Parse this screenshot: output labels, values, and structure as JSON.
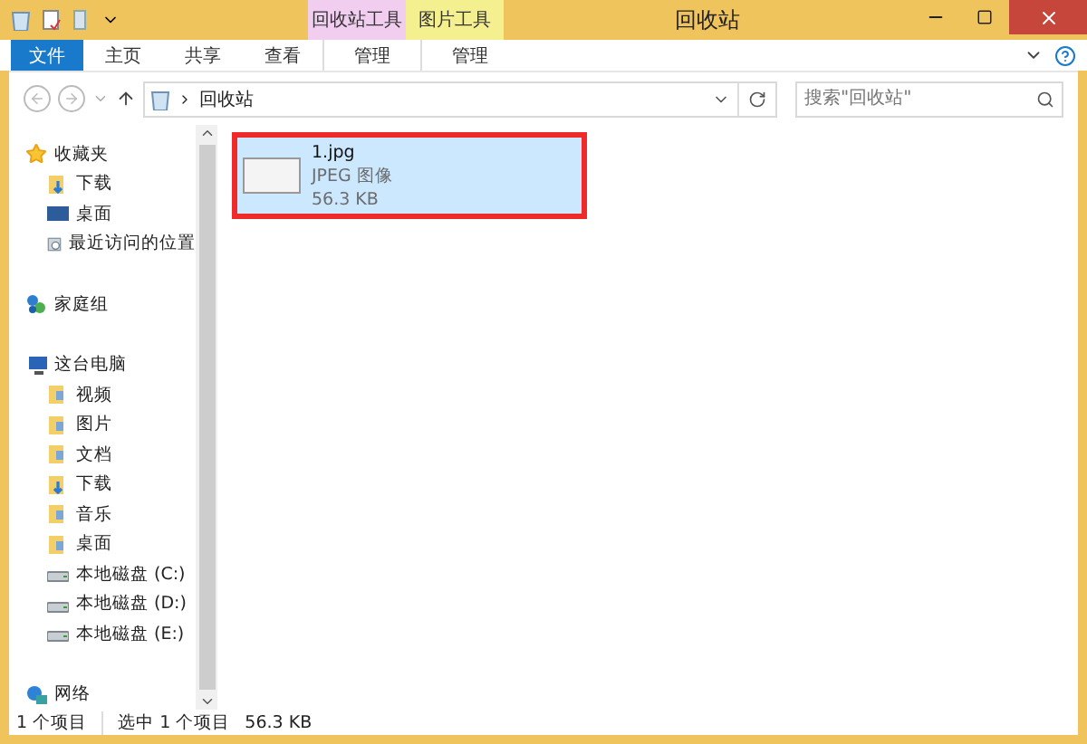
{
  "window": {
    "title": "回收站"
  },
  "context_groups": [
    {
      "label": "回收站工具",
      "color": "#f1cdf0"
    },
    {
      "label": "图片工具",
      "color": "#f4ef8f"
    }
  ],
  "ribbon_tabs": [
    {
      "label": "文件",
      "kind": "file"
    },
    {
      "label": "主页",
      "kind": "normal"
    },
    {
      "label": "共享",
      "kind": "normal"
    },
    {
      "label": "查看",
      "kind": "normal"
    },
    {
      "label": "管理",
      "kind": "context"
    },
    {
      "label": "管理",
      "kind": "context"
    }
  ],
  "address": {
    "path": "回收站",
    "search_placeholder": "搜索\"回收站\""
  },
  "sidebar": {
    "groups": [
      {
        "label": "收藏夹",
        "children": [
          {
            "label": "下载"
          },
          {
            "label": "桌面"
          },
          {
            "label": "最近访问的位置"
          }
        ]
      },
      {
        "label": "家庭组"
      },
      {
        "label": "这台电脑",
        "children": [
          {
            "label": "视频"
          },
          {
            "label": "图片"
          },
          {
            "label": "文档"
          },
          {
            "label": "下载"
          },
          {
            "label": "音乐"
          },
          {
            "label": "桌面"
          },
          {
            "label": "本地磁盘 (C:)"
          },
          {
            "label": "本地磁盘 (D:)"
          },
          {
            "label": "本地磁盘 (E:)"
          }
        ]
      },
      {
        "label": "网络"
      }
    ]
  },
  "files": [
    {
      "name": "1.jpg",
      "type": "JPEG 图像",
      "size": "56.3 KB",
      "selected": true,
      "highlighted": true
    }
  ],
  "status_bar": [
    "1 个项目",
    "选中 1 个项目",
    "56.3 KB"
  ]
}
